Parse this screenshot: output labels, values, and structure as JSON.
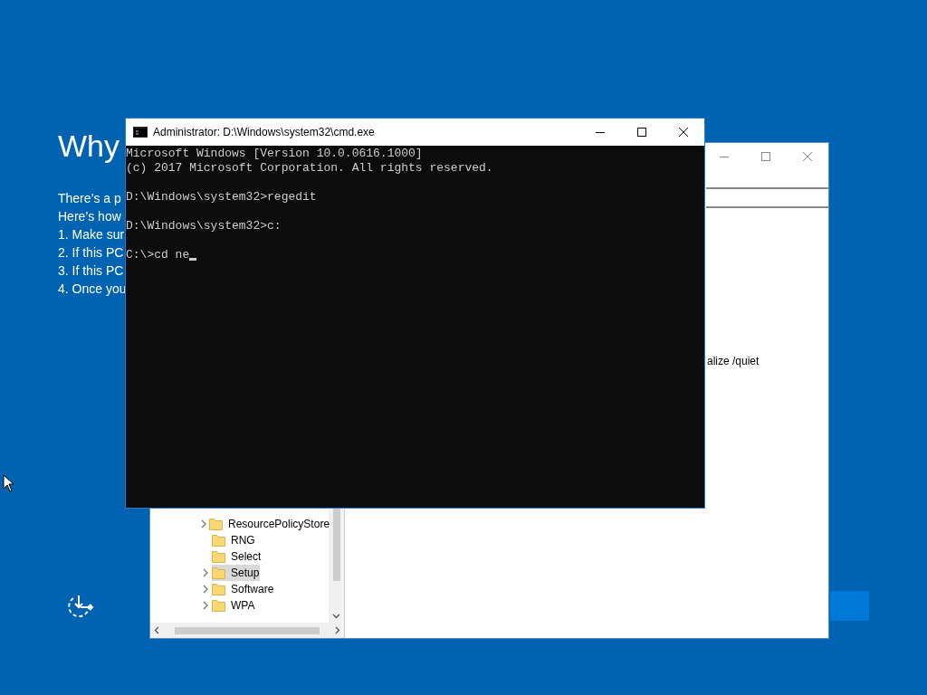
{
  "setup": {
    "heading": "Why",
    "lines": [
      "There’s a p",
      "Here’s how",
      "1. Make sur",
      "2. If this PC",
      "3. If this PC",
      "4. Once you"
    ]
  },
  "regedit": {
    "tree": [
      {
        "label": "ResourcePolicyStore",
        "expandable": true,
        "selected": false
      },
      {
        "label": "RNG",
        "expandable": false,
        "selected": false
      },
      {
        "label": "Select",
        "expandable": false,
        "selected": false
      },
      {
        "label": "Setup",
        "expandable": true,
        "selected": true
      },
      {
        "label": "Software",
        "expandable": true,
        "selected": false
      },
      {
        "label": "WPA",
        "expandable": true,
        "selected": false
      }
    ],
    "value_text": "alize /quiet"
  },
  "cmd": {
    "title": "Administrator: D:\\Windows\\system32\\cmd.exe",
    "blocks": [
      [
        "Microsoft Windows [Version 10.0.0616.1000]",
        "(c) 2017 Microsoft Corporation. All rights reserved."
      ],
      [
        "D:\\Windows\\system32>regedit"
      ],
      [
        "D:\\Windows\\system32>c:"
      ],
      [
        "C:\\>cd ne"
      ]
    ]
  }
}
